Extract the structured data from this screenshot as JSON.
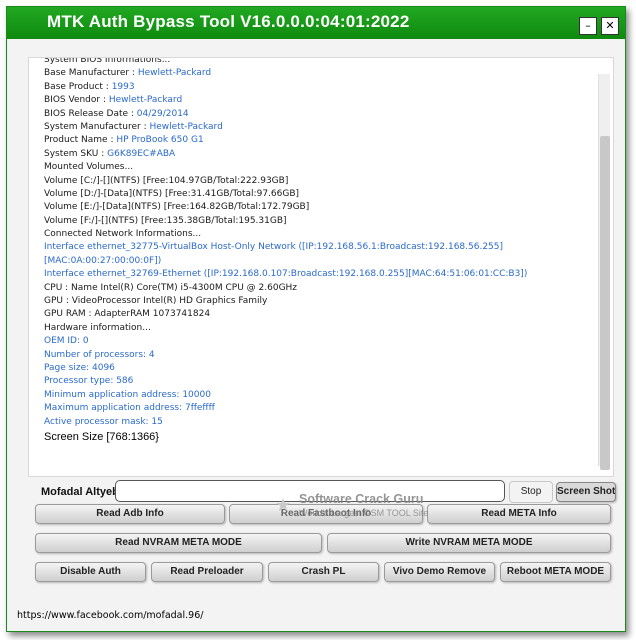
{
  "window": {
    "title": "MTK Auth Bypass Tool V16.0.0.0:04:01:2022",
    "minimize_glyph": "–",
    "close_glyph": "✕"
  },
  "log": {
    "partial_top": "System BIOS Informations...",
    "bios": [
      {
        "key": "Base Manufacturer : ",
        "value": "Hewlett-Packard"
      },
      {
        "key": "Base Product : ",
        "value": "1993"
      },
      {
        "key": "BIOS Vendor : ",
        "value": "Hewlett-Packard"
      },
      {
        "key": "BIOS Release Date : ",
        "value": "04/29/2014"
      },
      {
        "key": "System Manufacturer : ",
        "value": "Hewlett-Packard"
      },
      {
        "key": "Product Name : ",
        "value": "HP ProBook 650 G1"
      },
      {
        "key": "System SKU : ",
        "value": "G6K89EC#ABA"
      }
    ],
    "volumes_header": "Mounted Volumes...",
    "volumes": [
      "Volume [C:/]-[](NTFS) [Free:104.97GB/Total:222.93GB]",
      "Volume [D:/]-[Data](NTFS) [Free:31.41GB/Total:97.66GB]",
      "Volume [E:/]-[Data](NTFS) [Free:164.82GB/Total:172.79GB]",
      "Volume [F:/]-[](NTFS) [Free:135.38GB/Total:195.31GB]"
    ],
    "network_header": "Connected Network Informations...",
    "network": [
      "Interface ethernet_32775-VirtualBox Host-Only Network ([IP:192.168.56.1:Broadcast:192.168.56.255][MAC:0A:00:27:00:00:0F])",
      "Interface ethernet_32769-Ethernet ([IP:192.168.0.107:Broadcast:192.168.0.255][MAC:64:51:06:01:CC:B3])"
    ],
    "hardware_lines": [
      "CPU  : Name Intel(R) Core(TM) i5-4300M CPU @ 2.60GHz",
      "GPU  : VideoProcessor Intel(R) HD Graphics Family",
      "GPU RAM  : AdapterRAM 1073741824"
    ],
    "hardware_header": "Hardware information...",
    "hardware_info": [
      "OEM ID: 0",
      "Number of processors: 4",
      "Page size: 4096",
      "Processor type: 586",
      "Minimum application address: 10000",
      "Maximum application address: 7ffeffff",
      "Active processor mask: 15"
    ],
    "screen_size": "Screen Size [768:1366}"
  },
  "controls": {
    "name_label": "Mofadal Altyeb",
    "name_input_value": "",
    "stop_label": "Stop",
    "screenshot_label": "Screen Shot"
  },
  "buttons": {
    "read_adb": "Read Adb Info",
    "read_fastboot": "Read Fastboot Info",
    "read_meta": "Read META Info",
    "read_nvram": "Read NVRAM META MODE",
    "write_nvram": "Write NVRAM META MODE",
    "disable_auth": "Disable Auth",
    "read_preloader": "Read Preloader",
    "crash_pl": "Crash PL",
    "vivo_demo": "Vivo Demo Remove",
    "reboot_meta": "Reboot META MODE"
  },
  "watermark": {
    "star_glyph": "★",
    "title": "Software Crack Guru",
    "subtitle": "World's Largest GSM TOOL Site"
  },
  "status": {
    "url": "https://www.facebook.com/mofadal.96/"
  }
}
